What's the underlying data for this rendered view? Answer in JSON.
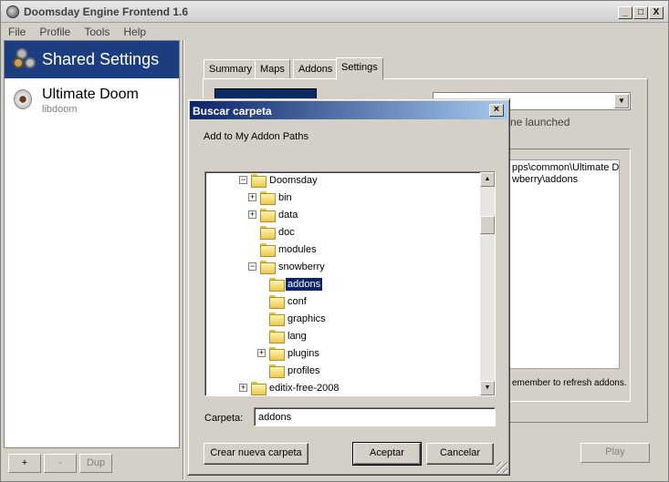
{
  "window": {
    "title": "Doomsday Engine Frontend 1.6",
    "min": "_",
    "max": "□",
    "close": "X"
  },
  "menu": [
    "File",
    "Profile",
    "Tools",
    "Help"
  ],
  "left": {
    "header": "Shared Settings",
    "game": {
      "title": "Ultimate Doom",
      "subtitle": "libdoom"
    },
    "buttons": {
      "add": "+",
      "remove": "-",
      "dup": "Dup"
    }
  },
  "tabs": [
    {
      "label": "Summary",
      "active": false
    },
    {
      "label": "Maps",
      "active": false
    },
    {
      "label": "Addons",
      "active": false
    },
    {
      "label": "Settings",
      "active": true
    }
  ],
  "settings": {
    "launched_text": "ne launched",
    "paths": [
      "pps\\common\\Ultimate Do",
      "wberry\\addons"
    ],
    "refresh_note": "emember to refresh addons.",
    "play": "Play"
  },
  "dialog": {
    "title": "Buscar carpeta",
    "close": "×",
    "prompt": "Add to My Addon Paths",
    "tree": [
      {
        "label": "Doomsday",
        "expander": "−"
      },
      {
        "label": "bin",
        "expander": "+"
      },
      {
        "label": "data",
        "expander": "+"
      },
      {
        "label": "doc",
        "expander": ""
      },
      {
        "label": "modules",
        "expander": ""
      },
      {
        "label": "snowberry",
        "expander": "−"
      },
      {
        "label": "addons",
        "expander": "",
        "selected": true
      },
      {
        "label": "conf",
        "expander": ""
      },
      {
        "label": "graphics",
        "expander": ""
      },
      {
        "label": "lang",
        "expander": ""
      },
      {
        "label": "plugins",
        "expander": "+"
      },
      {
        "label": "profiles",
        "expander": ""
      },
      {
        "label": "editix-free-2008",
        "expander": "+"
      }
    ],
    "folder_label": "Carpeta:",
    "folder_value": "addons",
    "buttons": {
      "new_folder": "Crear nueva carpeta",
      "ok": "Aceptar",
      "cancel": "Cancelar"
    }
  }
}
